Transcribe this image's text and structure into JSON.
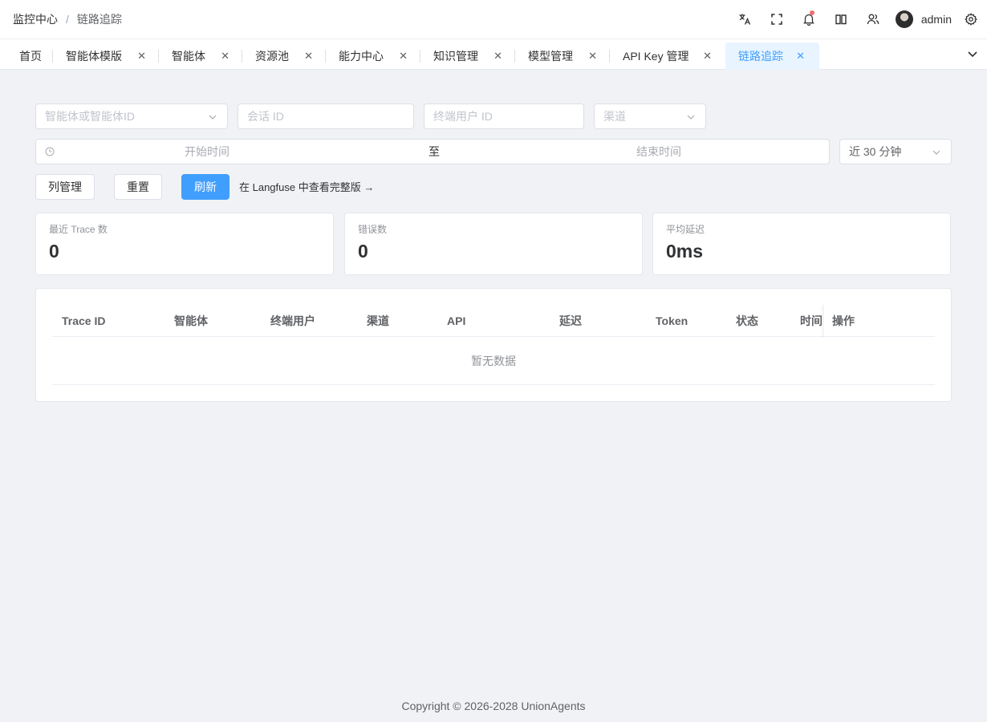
{
  "header": {
    "breadcrumb_root": "监控中心",
    "breadcrumb_separator": "/",
    "breadcrumb_current": "链路追踪",
    "icons": [
      "translate-icon",
      "fullscreen-icon",
      "bell-icon",
      "book-icon",
      "users-icon",
      "gear-icon"
    ],
    "username": "admin"
  },
  "tabs": [
    {
      "label": "首页",
      "closable": false,
      "active": false
    },
    {
      "label": "智能体模版",
      "closable": true,
      "active": false
    },
    {
      "label": "智能体",
      "closable": true,
      "active": false
    },
    {
      "label": "资源池",
      "closable": true,
      "active": false
    },
    {
      "label": "能力中心",
      "closable": true,
      "active": false
    },
    {
      "label": "知识管理",
      "closable": true,
      "active": false
    },
    {
      "label": "模型管理",
      "closable": true,
      "active": false
    },
    {
      "label": "API Key 管理",
      "closable": true,
      "active": false
    },
    {
      "label": "链路追踪",
      "closable": true,
      "active": true
    }
  ],
  "tab_close_glyph": "✕",
  "filters": {
    "agent_placeholder": "智能体或智能体ID",
    "session_placeholder": "会话 ID",
    "end_user_placeholder": "终端用户 ID",
    "channel_placeholder": "渠道",
    "start_time_placeholder": "开始时间",
    "range_separator": "至",
    "end_time_placeholder": "结束时间",
    "quick_range_value": "近 30 分钟"
  },
  "actions": {
    "columns_label": "列管理",
    "reset_label": "重置",
    "refresh_label": "刷新",
    "langfuse_link": "在 Langfuse 中查看完整版 →"
  },
  "stats": [
    {
      "label": "最近 Trace 数",
      "value": "0"
    },
    {
      "label": "错误数",
      "value": "0"
    },
    {
      "label": "平均延迟",
      "value": "0ms"
    }
  ],
  "table": {
    "columns": [
      "Trace ID",
      "智能体",
      "终端用户",
      "渠道",
      "API",
      "延迟",
      "Token",
      "状态",
      "时间",
      "操作"
    ],
    "empty_text": "暂无数据"
  },
  "footer": {
    "copyright": "Copyright © 2026-2028 UnionAgents"
  },
  "colors": {
    "primary": "#409eff",
    "active_tab_bg": "#e8f4ff",
    "notification_dot": "#f56c6c",
    "page_bg": "#f0f2f5"
  }
}
